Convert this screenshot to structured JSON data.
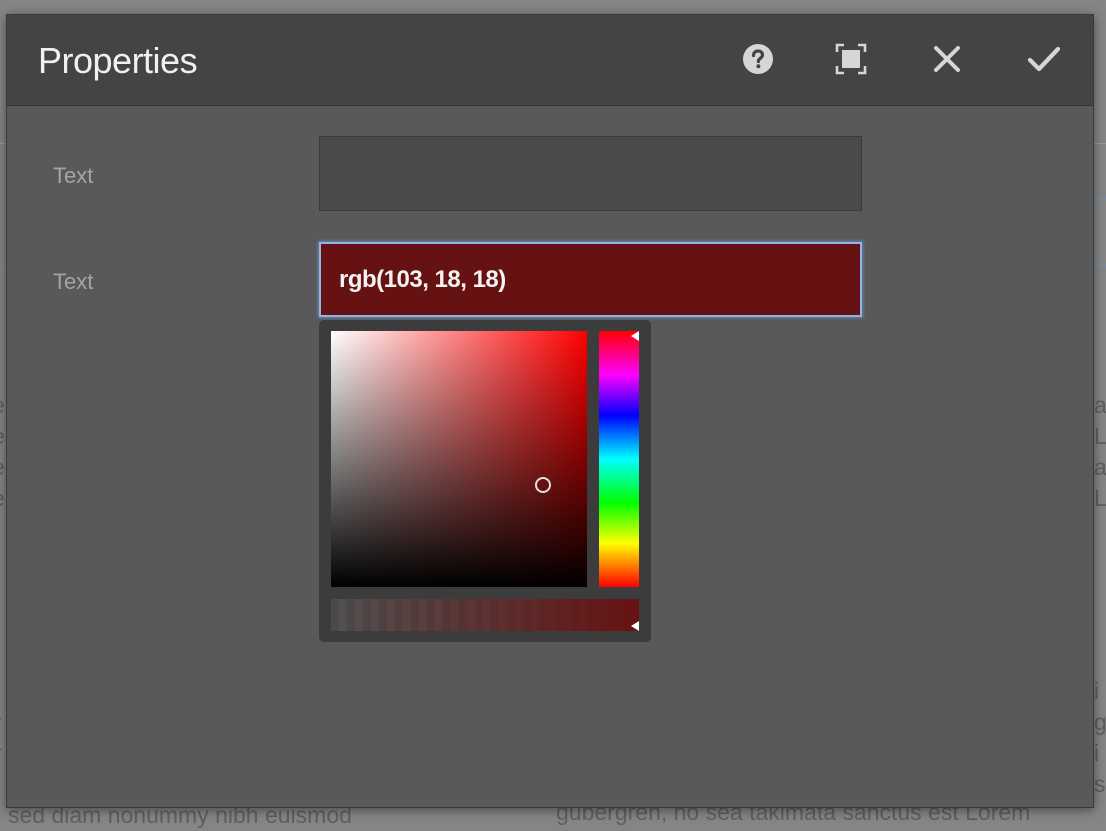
{
  "dialog": {
    "title": "Properties",
    "buttons": {
      "help": "help-icon",
      "fullscreen": "fullscreen-icon",
      "close": "close-icon",
      "done": "check-icon"
    }
  },
  "fields": [
    {
      "label": "Text",
      "value": ""
    },
    {
      "label": "Text",
      "value": "rgb(103, 18, 18)"
    }
  ],
  "color_picker": {
    "selected_color": "#671212",
    "hue": 0,
    "saturation": 0.83,
    "brightness": 0.4,
    "alpha": 1
  },
  "background_text": {
    "bottom_left": "sed diam nonummy nibh euismod",
    "bottom_right": "gubergren, no sea takimata sanctus est Lorem"
  },
  "colors": {
    "dialog_bg": "#595959",
    "header_bg": "#444444",
    "focus_border": "#8fb5e8"
  }
}
